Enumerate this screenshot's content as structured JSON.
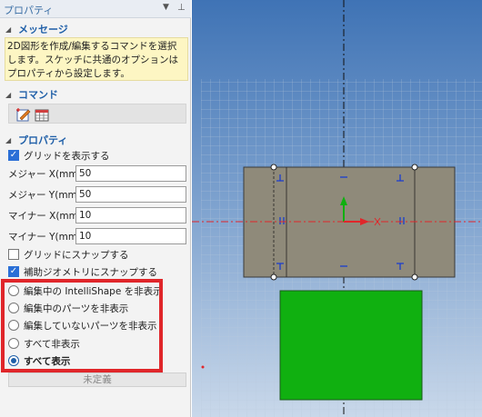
{
  "panel": {
    "title": "プロパティ",
    "title_icons": [
      "dropdown-arrow-icon",
      "pin-icon"
    ]
  },
  "message_section": {
    "header": "メッセージ",
    "text": "2D図形を作成/編集するコマンドを選択します。スケッチに共通のオプションはプロパティから設定します。"
  },
  "command_section": {
    "header": "コマンド",
    "buttons": [
      "edit-sketch-icon",
      "grid-table-icon"
    ]
  },
  "properties_section": {
    "header": "プロパティ",
    "show_grid": {
      "label": "グリッドを表示する",
      "checked": true
    },
    "fields": [
      {
        "label": "メジャー X(mm)",
        "value": "50"
      },
      {
        "label": "メジャー Y(mm)",
        "value": "50"
      },
      {
        "label": "マイナー X(mm)",
        "value": "10"
      },
      {
        "label": "マイナー Y(mm)",
        "value": "10"
      }
    ],
    "snap_grid": {
      "label": "グリッドにスナップする",
      "checked": false
    },
    "snap_aux": {
      "label": "補助ジオメトリにスナップする",
      "checked": true
    },
    "radio_options": [
      {
        "label": "編集中の IntelliShape を非表示",
        "selected": false
      },
      {
        "label": "編集中のパーツを非表示",
        "selected": false
      },
      {
        "label": "編集していないパーツを非表示",
        "selected": false
      },
      {
        "label": "すべて非表示",
        "selected": false
      },
      {
        "label": "すべて表示",
        "selected": true
      }
    ],
    "undefined_button": "未定義"
  },
  "colors": {
    "viewport_top": "#3f73b5",
    "viewport_bottom": "#c9d8ea",
    "sketch_part": "#8f8a7a",
    "green_part": "#10b010",
    "highlight_box": "#e0262a",
    "axis_red": "#e0262a",
    "constraint_blue": "#1a3ccf"
  }
}
